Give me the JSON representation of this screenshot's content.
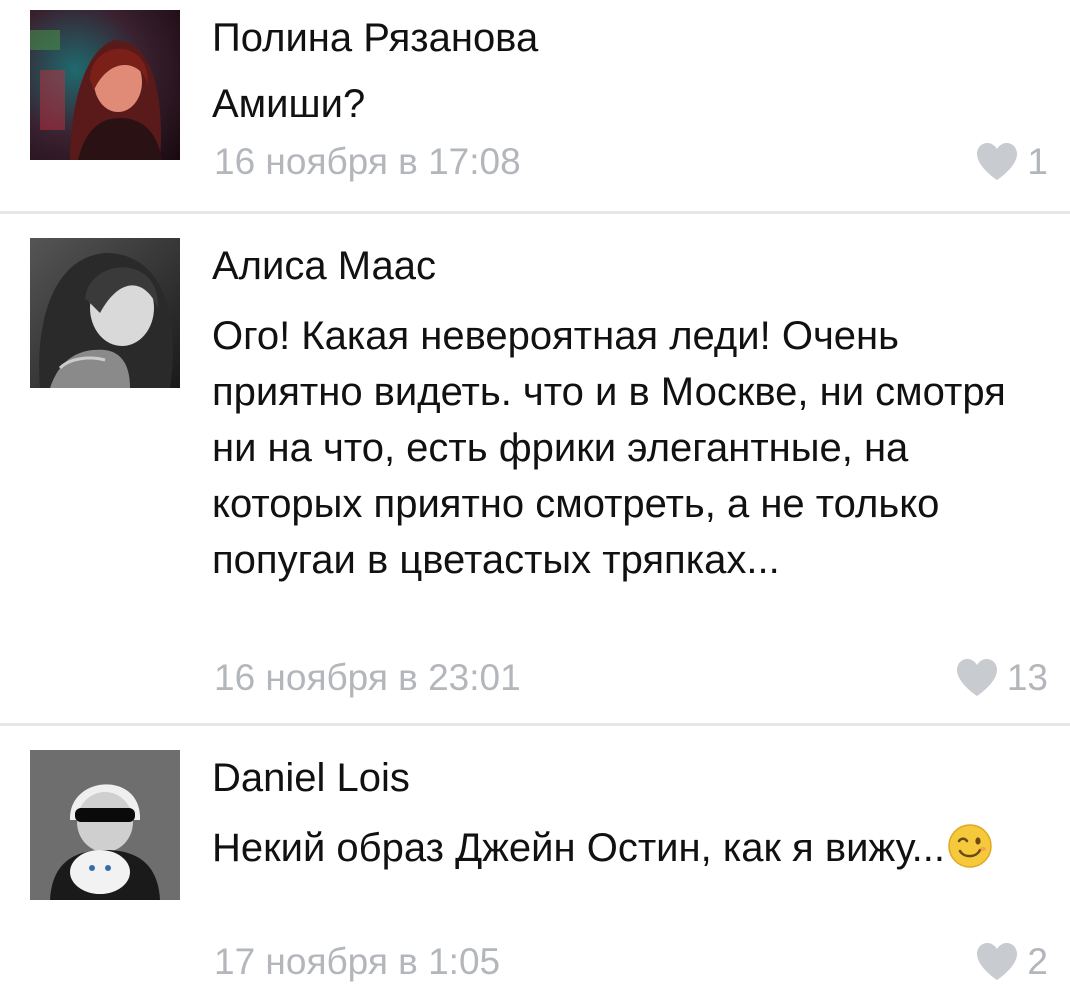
{
  "comments": [
    {
      "author": "Полина Рязанова",
      "text": "Амиши?",
      "date": "16 ноября в 17:08",
      "likes": "1",
      "avatar_icon": "avatar-photo"
    },
    {
      "author": "Алиса Маас",
      "text": "Ого! Какая невероятная леди! Очень приятно видеть. что и в Москве, ни смотря ни на что, есть фрики элегантные, на которых приятно смотреть, а не только попугаи в цветастых тряпках...",
      "date": "16 ноября в 23:01",
      "likes": "13",
      "avatar_icon": "avatar-photo"
    },
    {
      "author": "Daniel Lois",
      "text": "Некий образ Джейн Остин, как я вижу...",
      "date": "17 ноября в 1:05",
      "likes": "2",
      "avatar_icon": "avatar-photo",
      "emoji": "wink-emoji"
    }
  ],
  "colors": {
    "meta": "#b3b6ba",
    "text": "#111111",
    "divider": "#e6e7e9"
  }
}
